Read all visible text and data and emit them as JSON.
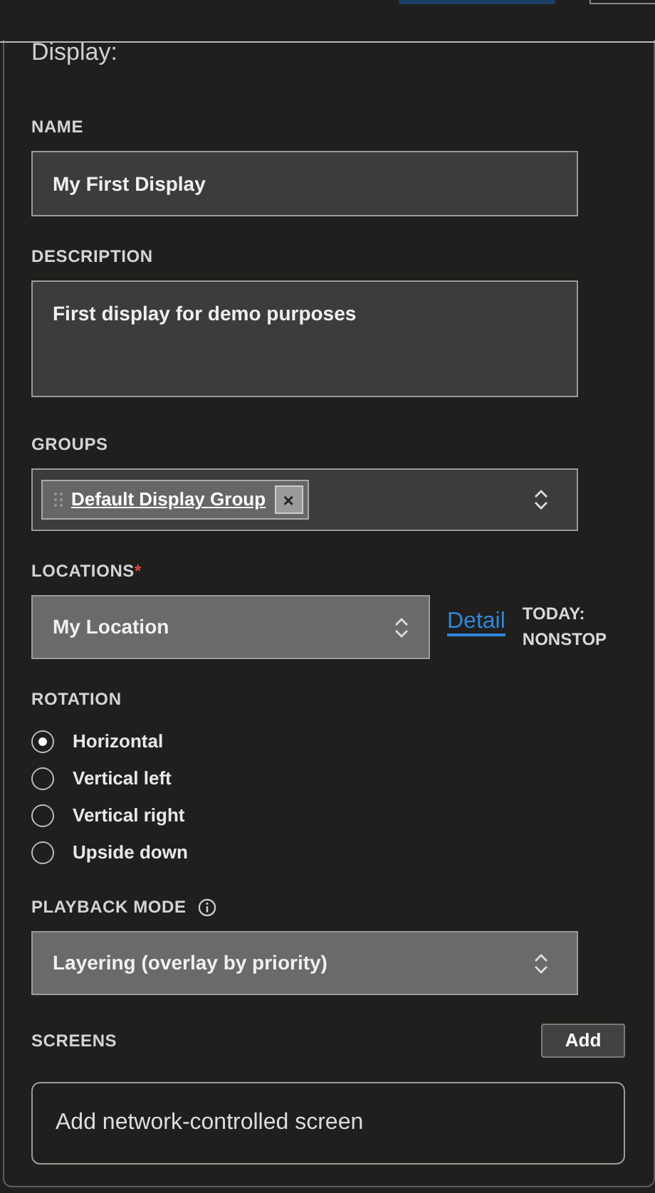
{
  "panel_title": "Display:",
  "name": {
    "label": "NAME",
    "value": "My First Display"
  },
  "description": {
    "label": "DESCRIPTION",
    "value": "First display for demo purposes"
  },
  "groups": {
    "label": "GROUPS",
    "tags": [
      {
        "label": "Default Display Group",
        "remove": "×"
      }
    ]
  },
  "locations": {
    "label": "LOCATIONS",
    "required_mark": "*",
    "value": "My Location",
    "link": "Detail",
    "schedule": [
      "TODAY:",
      "NONSTOP"
    ]
  },
  "rotation": {
    "label": "ROTATION",
    "options": [
      {
        "label": "Horizontal",
        "selected": true
      },
      {
        "label": "Vertical left",
        "selected": false
      },
      {
        "label": "Vertical right",
        "selected": false
      },
      {
        "label": "Upside down",
        "selected": false
      }
    ]
  },
  "playback_mode": {
    "label": "PLAYBACK MODE",
    "info": true,
    "value": "Layering (overlay by priority)"
  },
  "screens": {
    "label": "SCREENS",
    "button": "Add",
    "empty_action": "Add network-controlled screen"
  }
}
